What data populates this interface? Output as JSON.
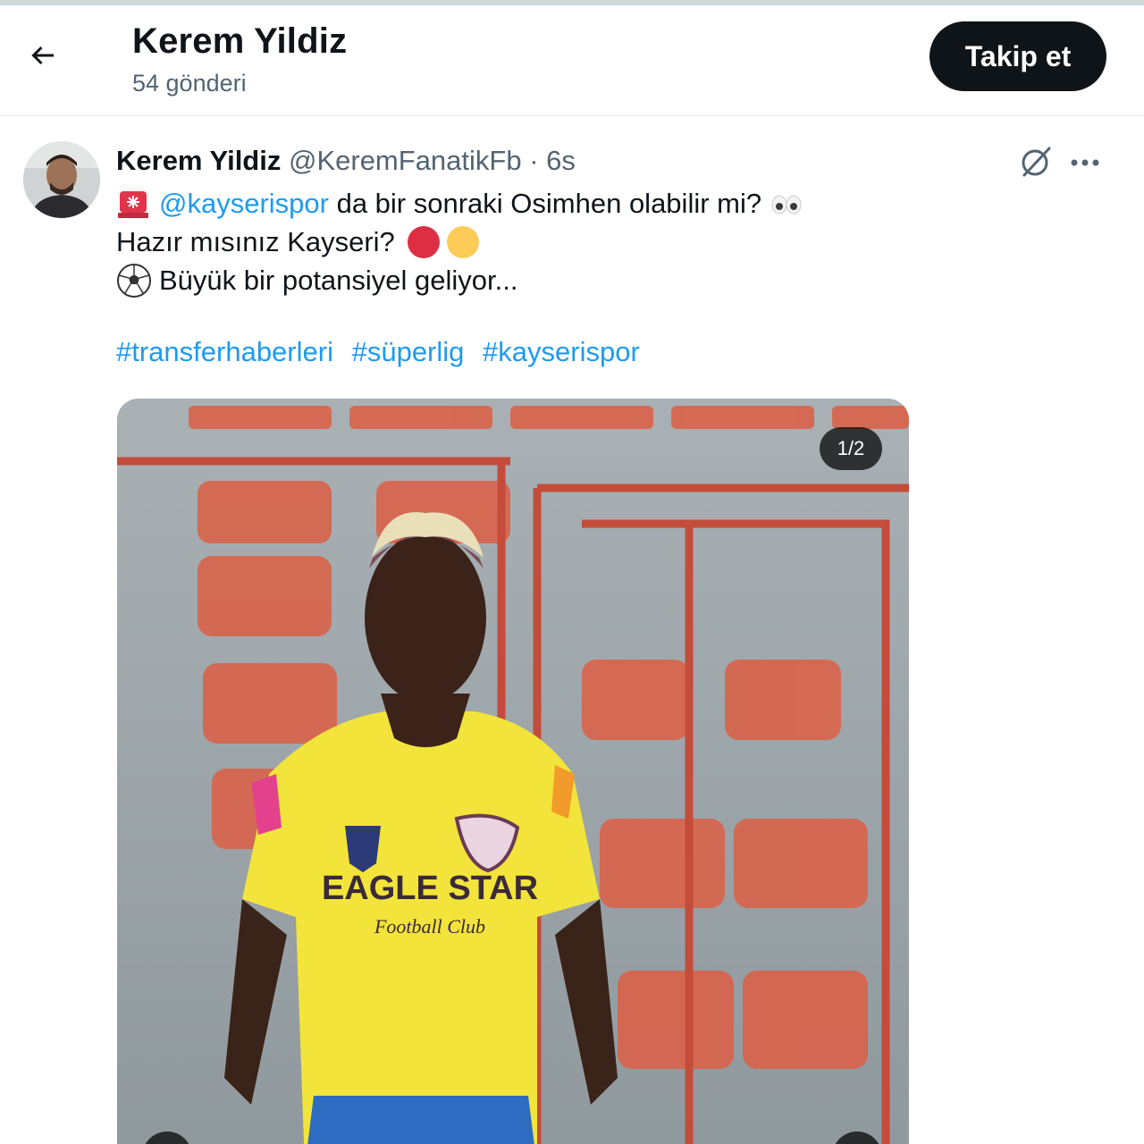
{
  "header": {
    "back_icon": "arrow-left-icon",
    "name": "Kerem Yildiz",
    "post_count": "54 gönderi",
    "follow_label": "Takip et"
  },
  "post": {
    "author_name": "Kerem Yildiz",
    "handle": "@KeremFanatikFb",
    "separator": "·",
    "time": "6s",
    "line1_mention": "@kayserispor",
    "line1_rest": " da bir sonraki Osimhen olabilir mi?",
    "line2": "Hazır mısınız Kayseri?",
    "line3": "Büyük bir potansiyel geliyor...",
    "hashtags": [
      "#transferhaberleri",
      "#süperlig",
      "#kayserispor"
    ],
    "icons": [
      "siren-emoji",
      "eyes-emoji",
      "red-circle-emoji",
      "yellow-circle-emoji",
      "soccer-ball-emoji",
      "grok-icon",
      "more-icon"
    ],
    "media": {
      "counter": "1/2",
      "jersey_text": "EAGLE STAR",
      "jersey_subtext": "Football Club"
    }
  },
  "colors": {
    "accent": "#1d9bf0",
    "follow_bg": "#0f1419",
    "secondary_text": "#536471",
    "jersey_yellow": "#f2e43a",
    "seat_red": "#d9634a"
  }
}
